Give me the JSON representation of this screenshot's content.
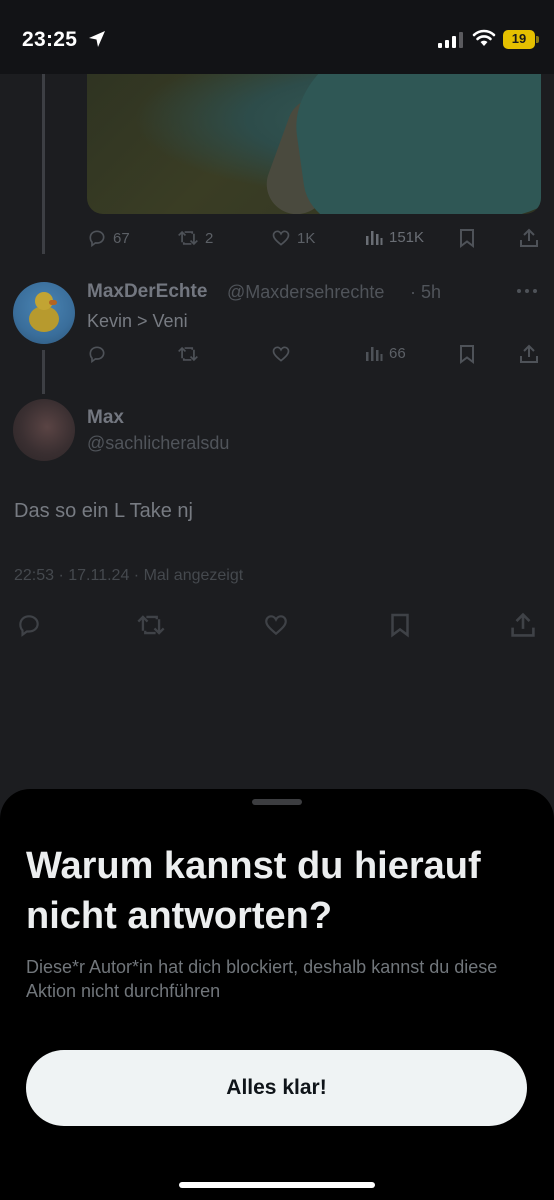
{
  "status_bar": {
    "time": "23:25",
    "battery": "19",
    "battery_color": "#e5c000"
  },
  "thread": {
    "parent_tweet": {
      "stats": {
        "replies": "67",
        "retweets": "2",
        "likes": "1K",
        "views": "151K"
      }
    },
    "reply": {
      "display_name": "MaxDerEchte",
      "handle": "@Maxdersehrechte",
      "time": "· 5h",
      "text": "Kevin > Veni",
      "stats": {
        "views": "66"
      }
    },
    "focused_tweet": {
      "display_name": "Max",
      "handle": "@sachlicheralsdu",
      "text": "Das so ein L Take nj",
      "meta": "22:53 · 17.11.24 · Mal angezeigt"
    }
  },
  "sheet": {
    "title": "Warum kannst du hierauf nicht antworten?",
    "message": "Diese*r Autor*in hat dich blockiert, deshalb kannst du diese Aktion nicht durchführen",
    "button_label": "Alles klar!"
  },
  "icons": [
    "location-arrow-icon",
    "signal-icon",
    "wifi-icon",
    "battery-icon",
    "reply-icon",
    "retweet-icon",
    "like-icon",
    "views-icon",
    "bookmark-icon",
    "share-icon",
    "more-icon"
  ]
}
